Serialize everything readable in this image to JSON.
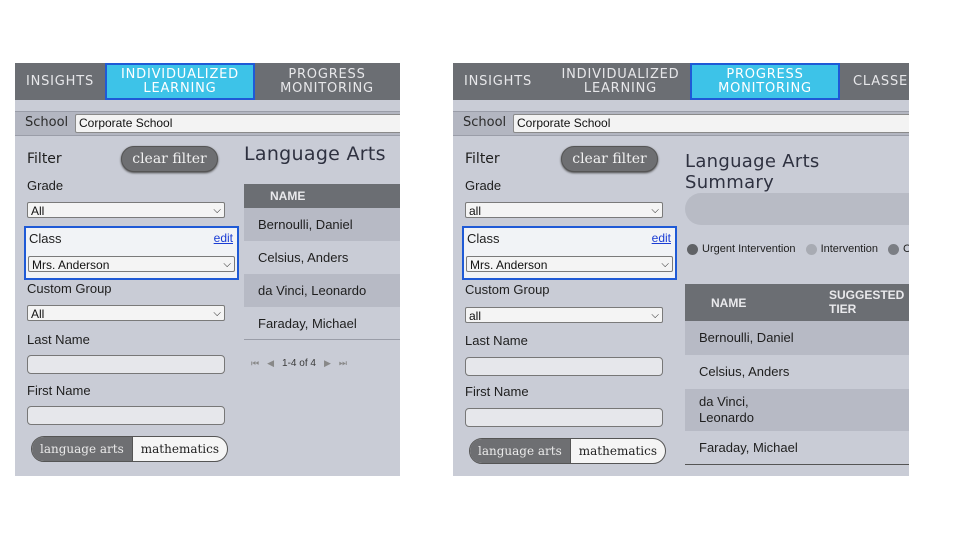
{
  "colors": {
    "nav_bg": "#6b6e73",
    "active_tab": "#3dc3e8",
    "highlight_border": "#1f5ad6",
    "panel_bg": "#c9ccd6",
    "urgent": "#606266",
    "intervention": "#a8abb3",
    "third_legend": "#7b7e84"
  },
  "left": {
    "nav": [
      {
        "label": "INSIGHTS"
      },
      {
        "label": "INDIVIDUALIZED\nLEARNING"
      },
      {
        "label": "PROGRESS\nMONITORING"
      }
    ],
    "school_label": "School",
    "school_value": "Corporate School",
    "filter_label": "Filter",
    "clear_filter": "clear filter",
    "grade_label": "Grade",
    "grade_value": "All",
    "class_label": "Class",
    "edit_label": "edit",
    "class_value": "Mrs. Anderson",
    "custom_group_label": "Custom Group",
    "custom_group_value": "All",
    "last_name_label": "Last Name",
    "first_name_label": "First Name",
    "subject_on": "language arts",
    "subject_off": "mathematics",
    "title": "Language Arts",
    "table_header": "NAME",
    "rows": [
      "Bernoulli, Daniel",
      "Celsius, Anders",
      "da Vinci, Leonardo",
      "Faraday, Michael"
    ],
    "pager_text": "1-4 of 4"
  },
  "right": {
    "nav": [
      {
        "label": "INSIGHTS"
      },
      {
        "label": "INDIVIDUALIZED\nLEARNING"
      },
      {
        "label": "PROGRESS\nMONITORING"
      },
      {
        "label": "CLASSE"
      }
    ],
    "school_label": "School",
    "school_value": "Corporate School",
    "filter_label": "Filter",
    "clear_filter": "clear filter",
    "grade_label": "Grade",
    "grade_value": "all",
    "class_label": "Class",
    "edit_label": "edit",
    "class_value": "Mrs. Anderson",
    "custom_group_label": "Custom Group",
    "custom_group_value": "all",
    "last_name_label": "Last Name",
    "first_name_label": "First Name",
    "subject_on": "language arts",
    "subject_off": "mathematics",
    "title": "Language Arts Summary",
    "legend": [
      {
        "label": "Urgent Intervention"
      },
      {
        "label": "Intervention"
      },
      {
        "label": "C"
      }
    ],
    "table_header_name": "NAME",
    "table_header_tier": "SUGGESTED\nTIER",
    "rows": [
      "Bernoulli, Daniel",
      "Celsius, Anders",
      "da Vinci,\nLeonardo",
      "Faraday, Michael"
    ]
  }
}
